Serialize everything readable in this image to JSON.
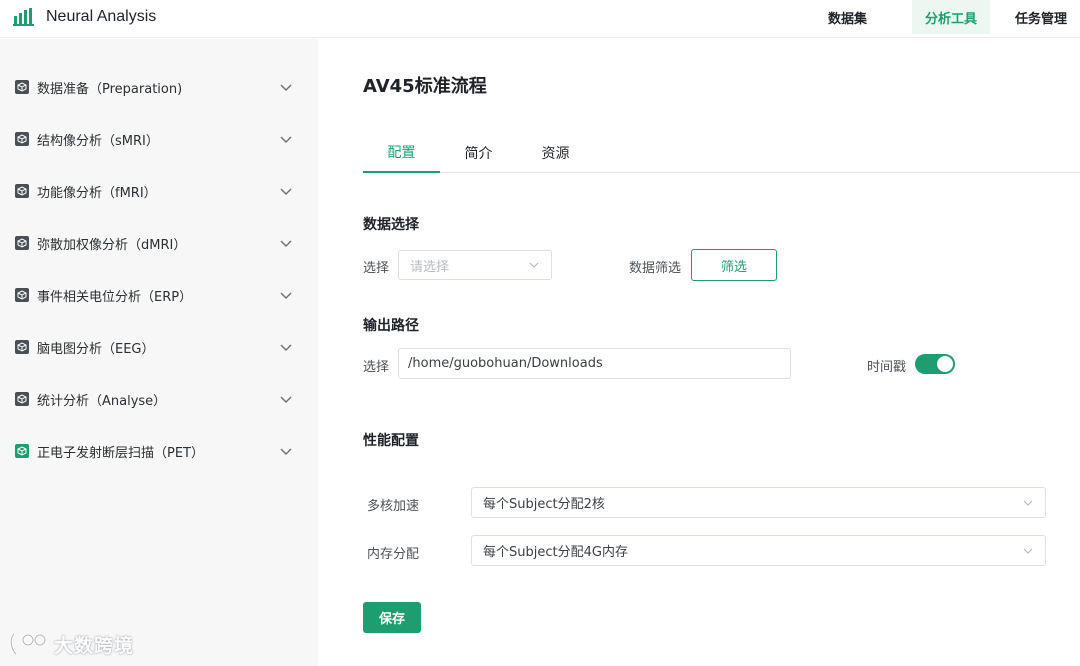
{
  "app": {
    "title": "Neural Analysis"
  },
  "nav": {
    "items": [
      {
        "label": "数据集"
      },
      {
        "label": "分析工具"
      },
      {
        "label": "任务管理"
      }
    ],
    "active": "分析工具"
  },
  "sidebar": {
    "items": [
      {
        "label": "数据准备（Preparation)"
      },
      {
        "label": "结构像分析（sMRI）"
      },
      {
        "label": "功能像分析（fMRI）"
      },
      {
        "label": "弥散加权像分析（dMRI）"
      },
      {
        "label": "事件相关电位分析（ERP）"
      },
      {
        "label": "脑电图分析（EEG）"
      },
      {
        "label": "统计分析（Analyse）"
      },
      {
        "label": "正电子发射断层扫描（PET）"
      }
    ]
  },
  "watermark": {
    "text": "大数跨境"
  },
  "main": {
    "title": "AV45标准流程",
    "tabs": [
      {
        "label": "配置"
      },
      {
        "label": "简介"
      },
      {
        "label": "资源"
      }
    ],
    "data_select": {
      "title": "数据选择",
      "select_label": "选择",
      "select_placeholder": "请选择",
      "filter_label": "数据筛选",
      "filter_button": "筛选"
    },
    "output": {
      "title": "输出路径",
      "select_label": "选择",
      "path": "/home/guobohuan/Downloads",
      "timestamp_label": "时间戳",
      "timestamp_on": true
    },
    "performance": {
      "title": "性能配置",
      "multicore_label": "多核加速",
      "multicore_value": "每个Subject分配2核",
      "memory_label": "内存分配",
      "memory_value": "每个Subject分配4G内存"
    },
    "save_button": "保存"
  },
  "colors": {
    "accent": "#1e9e70",
    "sidebar_bg": "#f7f7f7",
    "active_nav_bg": "#ecf7f2"
  }
}
